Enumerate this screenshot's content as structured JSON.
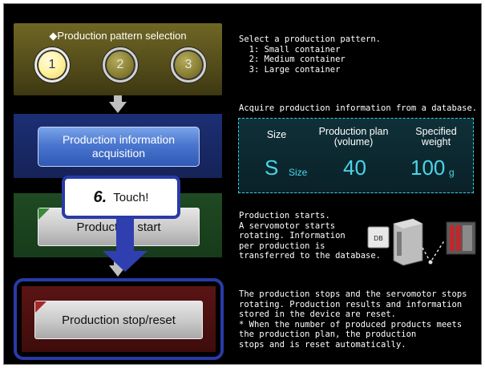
{
  "pattern": {
    "title": "◆Production pattern selection",
    "buttons": [
      "1",
      "2",
      "3"
    ],
    "selected": "1"
  },
  "info_button": {
    "label_line1": "Production information",
    "label_line2": "acquisition"
  },
  "start_button": {
    "label": "Production start"
  },
  "stop_button": {
    "label": "Production stop/reset"
  },
  "callout": {
    "step": "6.",
    "text": "Touch!"
  },
  "descriptions": {
    "pattern": "Select a production pattern.\n  1: Small container\n  2: Medium container\n  3: Large container",
    "acquire": "Acquire production information from a database.",
    "start": "Production starts.\nA servomotor starts\nrotating. Information\nper production is\ntransferred to the database.",
    "stop": "The production stops and the servomotor stops\nrotating. Production results and information\nstored in the device are reset.\n* When the number of produced products meets\nthe production plan, the production\nstops and is reset automatically."
  },
  "data_panel": {
    "headers": {
      "size": "Size",
      "plan_line1": "Production plan",
      "plan_line2": "(volume)",
      "weight_line1": "Specified",
      "weight_line2": "weight"
    },
    "values": {
      "size": "S",
      "size_unit": "Size",
      "plan": "40",
      "weight": "100",
      "weight_unit": "g"
    }
  },
  "illustration": {
    "db_label": "DB"
  },
  "colors": {
    "accent_blue": "#2f3fb0",
    "cyan_value": "#49d6e8",
    "pattern_panel": "#5a521c",
    "info_panel": "#1c2f74",
    "start_panel": "#1e4a22",
    "stop_panel": "#5a1414"
  }
}
